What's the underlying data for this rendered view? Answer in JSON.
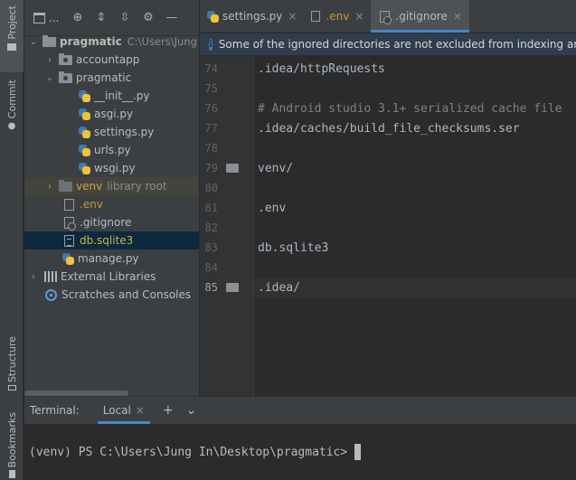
{
  "sidebar_left": {
    "project_label": "Project",
    "commit_label": "Commit",
    "structure_label": "Structure",
    "bookmarks_label": "Bookmarks"
  },
  "project_panel": {
    "selector_label": "...",
    "tree": {
      "root_name": "pragmatic",
      "root_path": "C:\\Users\\Jung",
      "items": [
        {
          "label": "accountapp"
        },
        {
          "label": "pragmatic"
        },
        {
          "label": "__init__.py"
        },
        {
          "label": "asgi.py"
        },
        {
          "label": "settings.py"
        },
        {
          "label": "urls.py"
        },
        {
          "label": "wsgi.py"
        },
        {
          "label": "venv",
          "suffix": "library root"
        },
        {
          "label": ".env"
        },
        {
          "label": ".gitignore"
        },
        {
          "label": "db.sqlite3"
        },
        {
          "label": "manage.py"
        },
        {
          "label": "External Libraries"
        },
        {
          "label": "Scratches and Consoles"
        }
      ]
    }
  },
  "editor": {
    "tabs": [
      {
        "label": "settings.py",
        "close": "×"
      },
      {
        "label": ".env",
        "close": "×"
      },
      {
        "label": ".gitignore",
        "close": "×"
      }
    ],
    "notice": "Some of the ignored directories are not excluded from indexing and se",
    "info_glyph": "i",
    "lines": [
      {
        "num": "74",
        "text": ".idea/httpRequests"
      },
      {
        "num": "75",
        "text": ""
      },
      {
        "num": "76",
        "text": "# Android studio 3.1+ serialized cache file"
      },
      {
        "num": "77",
        "text": ".idea/caches/build_file_checksums.ser"
      },
      {
        "num": "78",
        "text": ""
      },
      {
        "num": "79",
        "text": "venv/"
      },
      {
        "num": "80",
        "text": ""
      },
      {
        "num": "81",
        "text": ".env"
      },
      {
        "num": "82",
        "text": ""
      },
      {
        "num": "83",
        "text": "db.sqlite3"
      },
      {
        "num": "84",
        "text": ""
      },
      {
        "num": "85",
        "text": ".idea/"
      }
    ]
  },
  "terminal": {
    "title": "Terminal:",
    "tab_label": "Local",
    "tab_close": "×",
    "add_glyph": "+",
    "dropdown_glyph": "⌄",
    "prompt": "(venv) PS C:\\Users\\Jung In\\Desktop\\pragmatic>"
  }
}
